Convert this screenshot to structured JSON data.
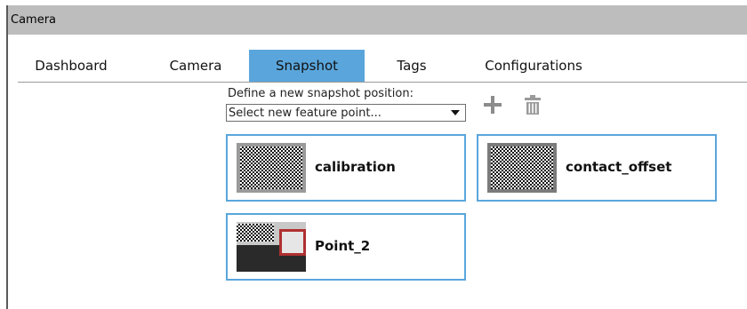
{
  "window": {
    "title": "Camera"
  },
  "tabs": [
    {
      "label": "Dashboard",
      "active": false
    },
    {
      "label": "Camera",
      "active": false
    },
    {
      "label": "Snapshot",
      "active": true
    },
    {
      "label": "Tags",
      "active": false
    },
    {
      "label": "Configurations",
      "active": false
    }
  ],
  "snapshot": {
    "define_label": "Define a new snapshot position:",
    "feature_select": {
      "value": "Select new feature point..."
    },
    "add_icon": "plus-icon",
    "delete_icon": "trash-icon",
    "positions": [
      {
        "label": "calibration"
      },
      {
        "label": "contact_offset"
      },
      {
        "label": "Point_2"
      }
    ]
  },
  "colors": {
    "accent": "#5aa6dc",
    "titlebar": "#bdbdbd",
    "icon_gray": "#8c8c8c"
  }
}
